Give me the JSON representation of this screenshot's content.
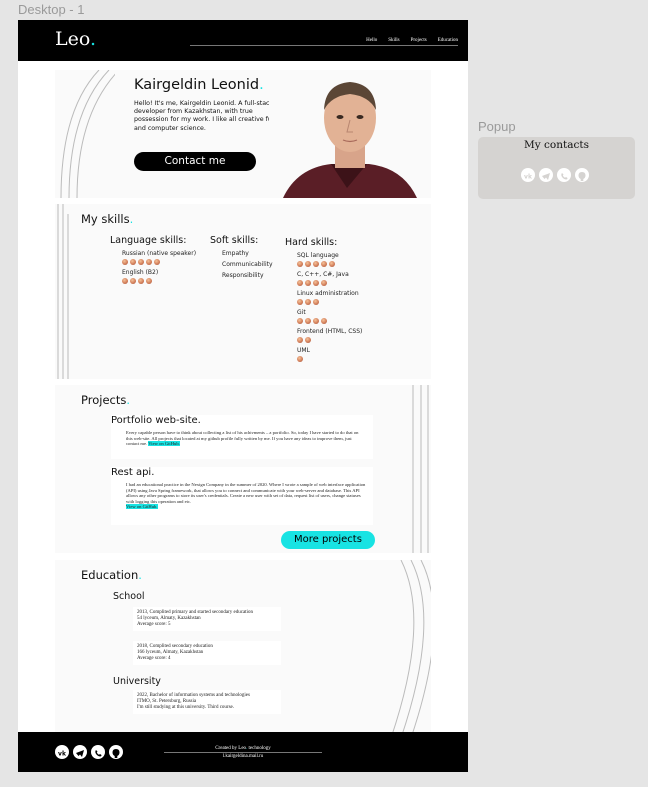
{
  "frames": {
    "desktop_label": "Desktop - 1",
    "popup_label": "Popup"
  },
  "header": {
    "logo": "Leo",
    "logo_dot": ".",
    "nav": [
      "Hello",
      "Skills",
      "Projects",
      "Education"
    ]
  },
  "hero": {
    "name": "Kairgeldin Leonid",
    "name_dot": ".",
    "text": "Hello! It's me, Kairgeldin Leonid. A full-stack developer from Kazakhstan, with true possession for my work. I like all creative fun and computer science.",
    "contact_button": "Contact me"
  },
  "skills": {
    "title": "My skills",
    "dot": ".",
    "language": {
      "heading": "Language skills:",
      "items": [
        {
          "name": "Russian (native speaker)",
          "level": 5
        },
        {
          "name": "English (B2)",
          "level": 4
        }
      ]
    },
    "soft": {
      "heading": "Soft skills:",
      "items": [
        "Empathy",
        "Communicability",
        "Responsibility"
      ]
    },
    "hard": {
      "heading": "Hard skills:",
      "items": [
        {
          "name": "SQL language",
          "level": 5
        },
        {
          "name": "C, C++, C#,  Java",
          "level": 4
        },
        {
          "name": "Linux administration",
          "level": 3
        },
        {
          "name": "Git",
          "level": 4
        },
        {
          "name": "Frontend (HTML, CSS)",
          "level": 2
        },
        {
          "name": "UML",
          "level": 1
        }
      ]
    }
  },
  "projects": {
    "title": "Projects",
    "dot": ".",
    "items": [
      {
        "title": "Portfolio web-site.",
        "description": "Every capable person have to think about collecting a list of his achivments – a portfolio. So, today I have started to do that on this web-site. All projects that located at my github profile fully written by me. If you have any ideas to improve them, just contact me.",
        "link": "View on GitHub."
      },
      {
        "title": "Rest api.",
        "description": "I had an educational practice in the Nexign Company in the summer of 2020. Where I wrote a sample of web interface application (API) using Java Spring framework, that allows you to connect and communicate with your web-server and database. This API allows any other programs to store its user's credentials. Create a new user with set of data, request list of users, change statuses with logging this operation and etc.",
        "link": "View on GitHub."
      }
    ],
    "more_button": "More projects"
  },
  "education": {
    "title": "Education",
    "dot": ".",
    "school_heading": "School",
    "school": [
      [
        "2013, Complited primary and started secondary education",
        "54 lyceum, Almaty, Kazakhstan",
        "Average score: 5"
      ],
      [
        "2018, Complited secondary education",
        "166 lyceum, Almaty, Kazakhstan",
        "Average score: 4"
      ]
    ],
    "university_heading": "University",
    "university": [
      [
        "2022, Bachelor of information systems and technologies",
        "ITMO, St. Petersburg, Russia",
        "I'm still studying at this university. Third course."
      ]
    ]
  },
  "footer": {
    "social_icons": [
      "vk-icon",
      "telegram-icon",
      "whatsapp-icon",
      "github-icon"
    ],
    "created_prefix": "Created by Leo",
    "created_dot": ".",
    "created_suffix": " technology",
    "email": "l.kairgeldina.mail.ru"
  },
  "popup": {
    "title": "My contacts",
    "social_icons": [
      "vk-icon",
      "telegram-icon",
      "whatsapp-icon",
      "github-icon"
    ]
  },
  "colors": {
    "accent": "#18e3e3",
    "dark": "#000000",
    "section_bg": "#fafafa",
    "canvas": "#e5e5e5",
    "popup_bg": "#d5d3d1"
  }
}
